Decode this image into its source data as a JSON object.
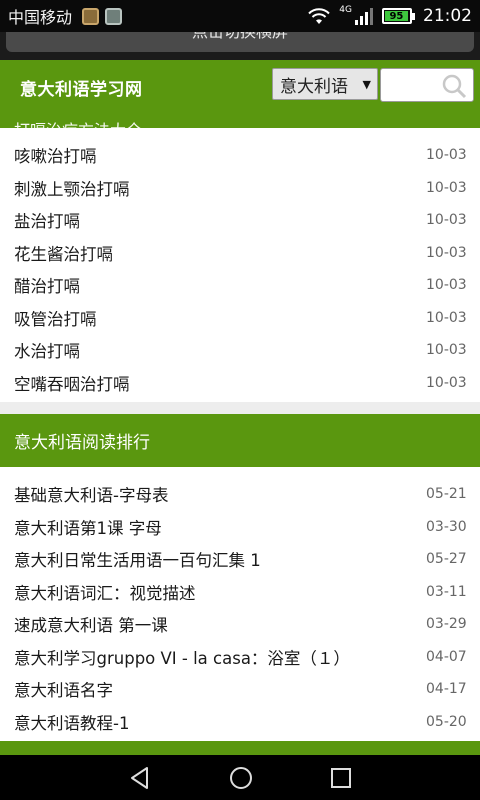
{
  "status_bar": {
    "carrier": "中国移动",
    "network": "4G",
    "battery": "95",
    "battery_level": 0.95,
    "time": "21:02"
  },
  "rotate_hint": "点击切换横屏",
  "header": {
    "logo": "意大利语学习网",
    "select_value": "意大利语",
    "search_placeholder": "",
    "cut_title": "打嗝治疗方法大全"
  },
  "list_latest": [
    {
      "title": "咳嗽治打嗝",
      "date": "10-03"
    },
    {
      "title": "刺激上颚治打嗝",
      "date": "10-03"
    },
    {
      "title": "盐治打嗝",
      "date": "10-03"
    },
    {
      "title": "花生酱治打嗝",
      "date": "10-03"
    },
    {
      "title": "醋治打嗝",
      "date": "10-03"
    },
    {
      "title": "吸管治打嗝",
      "date": "10-03"
    },
    {
      "title": "水治打嗝",
      "date": "10-03"
    },
    {
      "title": "空嘴吞咽治打嗝",
      "date": "10-03"
    }
  ],
  "ranking": {
    "title": "意大利语阅读排行",
    "items": [
      {
        "title": "基础意大利语-字母表",
        "date": "05-21"
      },
      {
        "title": "意大利语第1课 字母",
        "date": "03-30"
      },
      {
        "title": "意大利日常生活用语一百句汇集 1",
        "date": "05-27"
      },
      {
        "title": "意大利语词汇：视觉描述",
        "date": "03-11"
      },
      {
        "title": "速成意大利语 第一课",
        "date": "03-29"
      },
      {
        "title": "意大利学习gruppo VI - la casa：浴室（１）",
        "date": "04-07"
      },
      {
        "title": "意大利语名字",
        "date": "04-17"
      },
      {
        "title": "意大利语教程-1",
        "date": "05-20"
      }
    ]
  },
  "colors": {
    "brand_green": "#5a970f",
    "battery_green": "#3ec83e"
  },
  "icons": [
    "wifi-icon",
    "signal-icon",
    "battery-icon",
    "search-icon",
    "back-icon",
    "home-icon",
    "recents-icon"
  ]
}
